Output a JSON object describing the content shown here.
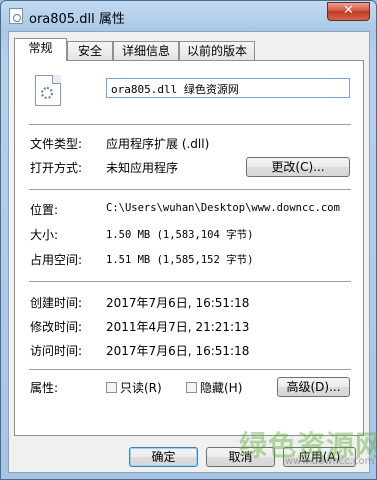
{
  "window": {
    "title": "ora805.dll 属性",
    "close_glyph": "✕"
  },
  "tabs": [
    {
      "label": "常规",
      "active": true
    },
    {
      "label": "安全",
      "active": false
    },
    {
      "label": "详细信息",
      "active": false
    },
    {
      "label": "以前的版本",
      "active": false
    }
  ],
  "general": {
    "file_name": "ora805.dll 绿色资源网",
    "file_type_label": "文件类型:",
    "file_type_value": "应用程序扩展 (.dll)",
    "opens_with_label": "打开方式:",
    "opens_with_value": "未知应用程序",
    "change_button": "更改(C)...",
    "location_label": "位置:",
    "location_value": "C:\\Users\\wuhan\\Desktop\\www.downcc.com",
    "size_label": "大小:",
    "size_value": "1.50 MB (1,583,104 字节)",
    "size_on_disk_label": "占用空间:",
    "size_on_disk_value": "1.51 MB (1,585,152 字节)",
    "created_label": "创建时间:",
    "created_value": "2017年7月6日, 16:51:18",
    "modified_label": "修改时间:",
    "modified_value": "2011年4月7日, 21:21:13",
    "accessed_label": "访问时间:",
    "accessed_value": "2017年7月6日, 16:51:18",
    "attributes_label": "属性:",
    "readonly_label": "只读(R)",
    "hidden_label": "隐藏(H)",
    "advanced_button": "高级(D)..."
  },
  "footer": {
    "ok_button": "确定",
    "cancel_button": "取消",
    "apply_button": "应用(A)"
  },
  "watermark": {
    "main": "绿色资源网",
    "url": "www.downcc.com"
  },
  "icons": {
    "title": "dll-file-icon",
    "file": "dll-file-gear-icon"
  },
  "colors": {
    "title_bar": "#b7d1ea",
    "close_button": "#c03a22",
    "default_button_border": "#3c7fb1",
    "watermark_green": "#5aaa2a"
  }
}
